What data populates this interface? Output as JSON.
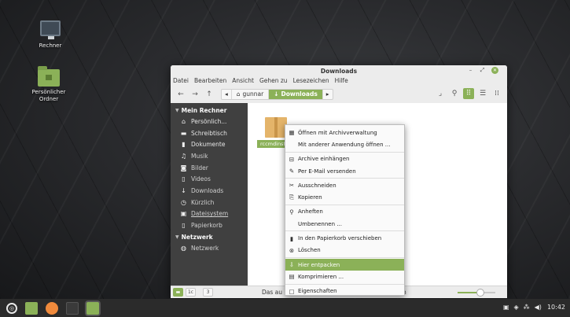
{
  "desktop": {
    "icons": [
      {
        "label": "Rechner"
      },
      {
        "label": "Persönlicher Ordner"
      }
    ]
  },
  "window": {
    "title": "Downloads",
    "controls": {
      "minimize": "–",
      "maximize": "⤢",
      "close": "✕"
    },
    "menubar": [
      "Datei",
      "Bearbeiten",
      "Ansicht",
      "Gehen zu",
      "Lesezeichen",
      "Hilfe"
    ],
    "toolbar": {
      "back": "←",
      "forward": "→",
      "up": "↑",
      "path_left_arrow": "◂",
      "path": [
        {
          "label": "gunnar",
          "icon": "home-icon",
          "glyph": "⌂"
        },
        {
          "label": "Downloads",
          "icon": "download-icon",
          "glyph": "↓"
        }
      ],
      "path_right_arrow": "▸",
      "right_tools": [
        {
          "icon": "toggle-location-icon",
          "glyph": "⌟"
        },
        {
          "icon": "search-icon",
          "glyph": "⚲"
        },
        {
          "icon": "icon-view-icon",
          "glyph": "⠿"
        },
        {
          "icon": "list-view-icon",
          "glyph": "☰"
        },
        {
          "icon": "compact-view-icon",
          "glyph": "⁞⁞"
        }
      ]
    },
    "sidebar": {
      "sections": [
        {
          "title": "Mein Rechner",
          "items": [
            {
              "label": "Persönlich...",
              "icon": "home-icon",
              "glyph": "⌂"
            },
            {
              "label": "Schreibtisch",
              "icon": "desktop-icon",
              "glyph": "▬"
            },
            {
              "label": "Dokumente",
              "icon": "document-icon",
              "glyph": "▮"
            },
            {
              "label": "Musik",
              "icon": "music-icon",
              "glyph": "♫"
            },
            {
              "label": "Bilder",
              "icon": "camera-icon",
              "glyph": "◙"
            },
            {
              "label": "Videos",
              "icon": "video-icon",
              "glyph": "▯"
            },
            {
              "label": "Downloads",
              "icon": "download-icon",
              "glyph": "↓"
            },
            {
              "label": "Kürzlich",
              "icon": "clock-icon",
              "glyph": "◷"
            },
            {
              "label": "Dateisystem",
              "icon": "drive-icon",
              "glyph": "▣"
            },
            {
              "label": "Papierkorb",
              "icon": "trash-icon",
              "glyph": "▯"
            }
          ]
        },
        {
          "title": "Netzwerk",
          "items": [
            {
              "label": "Netzwerk",
              "icon": "network-icon",
              "glyph": "◍"
            }
          ]
        }
      ]
    },
    "files": [
      {
        "name": "rccmdinst",
        "icon": "package-icon"
      }
    ],
    "statusbar": {
      "buttons": [
        "▬",
        "1c",
        "3"
      ],
      "text": "Das au",
      "text_end": "n",
      "zoom_level": 0.6
    }
  },
  "context_menu": {
    "items": [
      {
        "label": "Öffnen mit Archivverwaltung",
        "icon": "archive-manager-icon",
        "glyph": "▦"
      },
      {
        "label": "Mit anderer Anwendung öffnen ...",
        "icon": "",
        "glyph": ""
      },
      {
        "sep": true
      },
      {
        "label": "Archive einhängen",
        "icon": "mount-icon",
        "glyph": "⊟"
      },
      {
        "label": "Per E-Mail versenden",
        "icon": "attach-icon",
        "glyph": "✎"
      },
      {
        "sep": true
      },
      {
        "label": "Ausschneiden",
        "icon": "cut-icon",
        "glyph": "✂"
      },
      {
        "label": "Kopieren",
        "icon": "copy-icon",
        "glyph": "⎘"
      },
      {
        "sep": true
      },
      {
        "label": "Anheften",
        "icon": "pin-icon",
        "glyph": "⚲"
      },
      {
        "label": "Umbenennen ...",
        "icon": "",
        "glyph": ""
      },
      {
        "sep": true
      },
      {
        "label": "In den Papierkorb verschieben",
        "icon": "trash-icon",
        "glyph": "▮"
      },
      {
        "label": "Löschen",
        "icon": "delete-icon",
        "glyph": "⊗"
      },
      {
        "sep": true
      },
      {
        "label": "Hier entpacken",
        "icon": "extract-icon",
        "glyph": "⇩",
        "highlight": true
      },
      {
        "label": "Komprimieren ...",
        "icon": "compress-icon",
        "glyph": "▤"
      },
      {
        "sep": true
      },
      {
        "label": "Eigenschaften",
        "icon": "properties-icon",
        "glyph": "▢"
      }
    ]
  },
  "taskbar": {
    "apps": [
      {
        "icon": "menu-icon",
        "glyph": "◎"
      },
      {
        "icon": "show-desktop-icon",
        "color": "#8bb158"
      },
      {
        "icon": "firefox-icon",
        "color": "#f08a3c"
      },
      {
        "icon": "terminal-icon",
        "color": "#3a3a3a"
      },
      {
        "icon": "files-icon",
        "color": "#8bb158"
      }
    ],
    "tray": [
      {
        "icon": "clipboard-icon",
        "glyph": "▣"
      },
      {
        "icon": "shield-icon",
        "glyph": "◈"
      },
      {
        "icon": "network-icon",
        "glyph": "⁂"
      },
      {
        "icon": "volume-icon",
        "glyph": "◀)"
      }
    ],
    "clock": "10:42"
  }
}
